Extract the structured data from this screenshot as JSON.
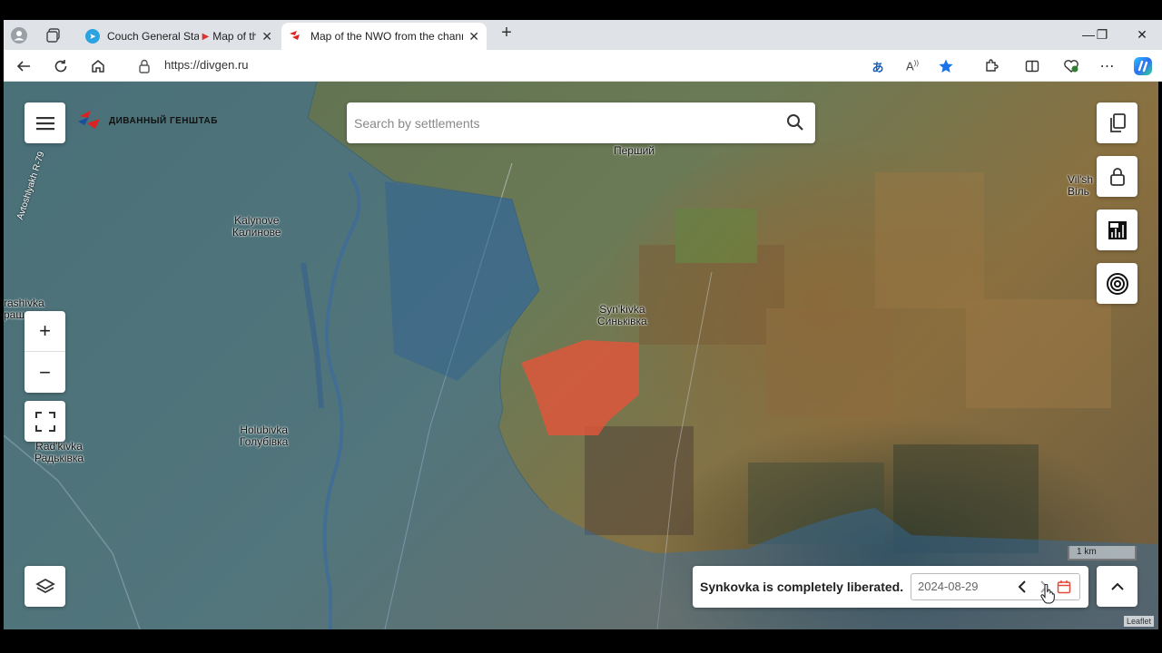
{
  "browser": {
    "tabs": [
      {
        "title": "Couch General Staff",
        "title2": "Map of th",
        "active": false
      },
      {
        "title": "Map of the NWO from the channe",
        "active": true
      }
    ],
    "url": "https://divgen.ru"
  },
  "map": {
    "logo_text": "ДИВАННЫЙ ГЕНШТАБ",
    "search_placeholder": "Search by settlements",
    "labels": {
      "pershyi": "Перший",
      "kalynove": "Kalynove",
      "kalynove_uk": "Калинове",
      "synkivka": "Syn'kivka",
      "synkivka_uk": "Синьківка",
      "holubivka": "Holubivka",
      "holubivka_uk": "Голубівка",
      "radkivka": "Rad'kivka",
      "radkivka_uk": "Радьківка",
      "kreshivka": "rashivka",
      "kreshivka_uk": "раш",
      "vilshana": "Vil'sh",
      "vilshana_uk": "Віль",
      "road": "Avtoshlyakh R-79"
    },
    "status_text": "Synkovka is completely liberated.",
    "date": "2024-08-29",
    "scale": "1 km",
    "attribution": "Leaflet"
  },
  "colors": {
    "blue_zone": "#2f6fb0",
    "red_zone": "#e2553a",
    "accent": "#1a73e8"
  }
}
